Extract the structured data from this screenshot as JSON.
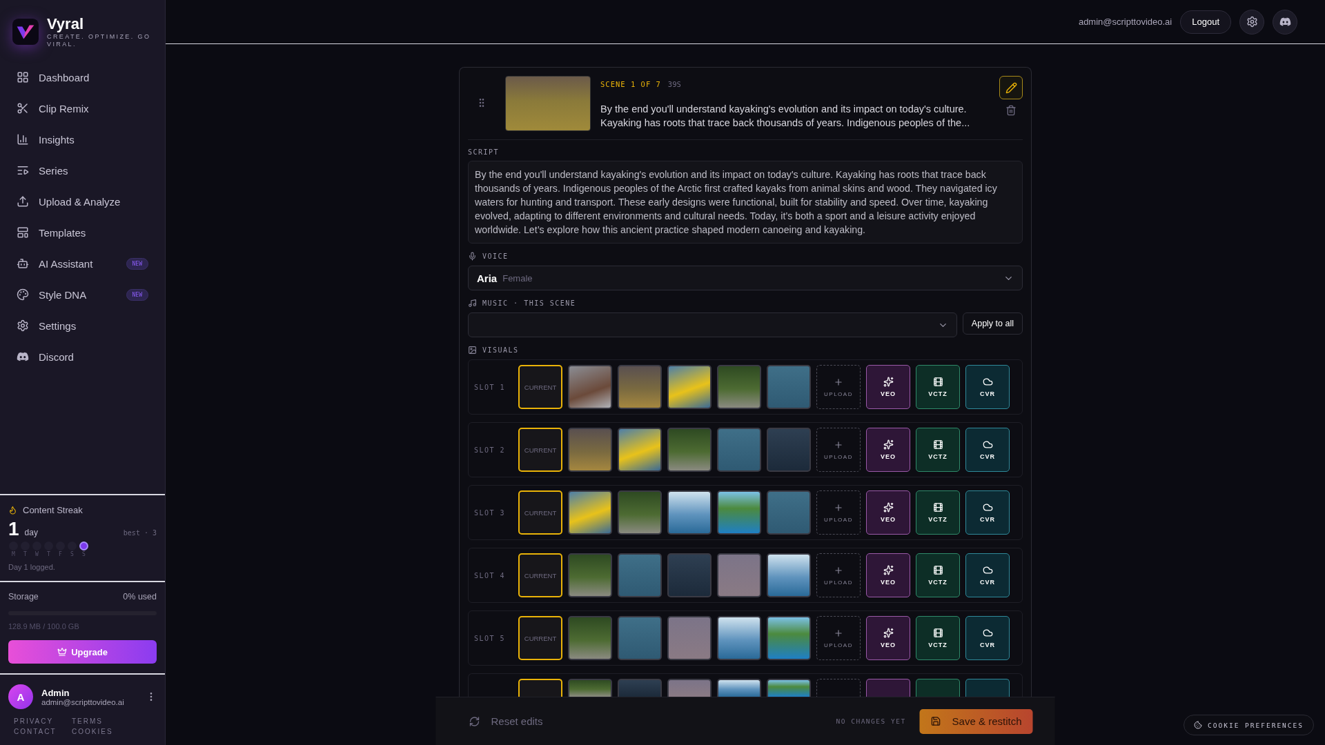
{
  "brand": {
    "name": "Vyral",
    "tagline": "CREATE. OPTIMIZE. GO VIRAL."
  },
  "nav": [
    {
      "label": "Dashboard"
    },
    {
      "label": "Clip Remix"
    },
    {
      "label": "Insights"
    },
    {
      "label": "Series"
    },
    {
      "label": "Upload & Analyze"
    },
    {
      "label": "Templates"
    },
    {
      "label": "AI Assistant",
      "badge": "NEW"
    },
    {
      "label": "Style DNA",
      "badge": "NEW"
    },
    {
      "label": "Settings"
    },
    {
      "label": "Discord"
    }
  ],
  "streak": {
    "title": "Content Streak",
    "count": "1",
    "unit": "day",
    "best": "best · 3",
    "days": [
      {
        "label": "M",
        "done": false
      },
      {
        "label": "T",
        "done": false
      },
      {
        "label": "W",
        "done": false
      },
      {
        "label": "T",
        "done": false
      },
      {
        "label": "F",
        "done": false
      },
      {
        "label": "S",
        "done": false
      },
      {
        "label": "S",
        "done": true
      }
    ],
    "note": "Day 1 logged."
  },
  "storage": {
    "label": "Storage",
    "used": "0% used",
    "detail": "128.9 MB / 100.0 GB"
  },
  "upgrade": "Upgrade",
  "user": {
    "initial": "A",
    "name": "Admin",
    "email": "admin@scripttovideo.ai"
  },
  "footer_links": [
    "PRIVACY",
    "TERMS",
    "CONTACT",
    "COOKIES"
  ],
  "header": {
    "email": "admin@scripttovideo.ai",
    "logout": "Logout"
  },
  "scene": {
    "counter": "SCENE 1 OF 7",
    "duration": "39S",
    "summary": "By the end you'll understand kayaking's evolution and its impact on today's culture. Kayaking has roots that trace back thousands of years. Indigenous peoples of the...",
    "script_label": "SCRIPT",
    "script": "By the end you'll understand kayaking's evolution and its impact on today's culture. Kayaking has roots that trace back thousands of years. Indigenous peoples of the Arctic first crafted kayaks from animal skins and wood. They navigated icy waters for hunting and transport. These early designs were functional, built for stability and speed. Over time, kayaking evolved, adapting to different environments and cultural needs. Today, it’s both a sport and a leisure activity enjoyed worldwide. Let’s explore how this ancient practice shaped modern canoeing and kayaking.",
    "voice_label": "VOICE",
    "voice": {
      "name": "Aria",
      "gender": "Female"
    },
    "music_label": "MUSIC · THIS SCENE",
    "apply_all": "Apply to all",
    "visuals_label": "VISUALS",
    "slots": [
      {
        "kind": "full",
        "label": "SLOT 1",
        "current": "CURRENT",
        "photos": [
          {
            "kind": "crowd"
          },
          {
            "kind": "people"
          },
          {
            "kind": "kayak"
          },
          {
            "kind": "shore"
          },
          {
            "kind": "water"
          }
        ],
        "upload": "UPLOAD",
        "generators": [
          {
            "kind": "veo",
            "label": "VEO"
          },
          {
            "kind": "vctz",
            "label": "VCTZ"
          },
          {
            "kind": "cvr",
            "label": "CVR"
          }
        ]
      },
      {
        "kind": "full",
        "label": "SLOT 2",
        "current": "CURRENT",
        "photos": [
          {
            "kind": "people"
          },
          {
            "kind": "kayak"
          },
          {
            "kind": "shore"
          },
          {
            "kind": "water"
          },
          {
            "kind": "dusk"
          }
        ],
        "upload": "UPLOAD",
        "generators": [
          {
            "kind": "veo",
            "label": "VEO"
          },
          {
            "kind": "vctz",
            "label": "VCTZ"
          },
          {
            "kind": "cvr",
            "label": "CVR"
          }
        ]
      },
      {
        "kind": "full",
        "label": "SLOT 3",
        "current": "CURRENT",
        "photos": [
          {
            "kind": "kayak"
          },
          {
            "kind": "shore"
          },
          {
            "kind": "paddler"
          },
          {
            "kind": "lake"
          },
          {
            "kind": "water"
          }
        ],
        "upload": "UPLOAD",
        "generators": [
          {
            "kind": "veo",
            "label": "VEO"
          },
          {
            "kind": "vctz",
            "label": "VCTZ"
          },
          {
            "kind": "cvr",
            "label": "CVR"
          }
        ]
      },
      {
        "kind": "full",
        "label": "SLOT 4",
        "current": "CURRENT",
        "photos": [
          {
            "kind": "shore"
          },
          {
            "kind": "water"
          },
          {
            "kind": "dusk"
          },
          {
            "kind": "rafters"
          },
          {
            "kind": "paddler"
          }
        ],
        "upload": "UPLOAD",
        "generators": [
          {
            "kind": "veo",
            "label": "VEO"
          },
          {
            "kind": "vctz",
            "label": "VCTZ"
          },
          {
            "kind": "cvr",
            "label": "CVR"
          }
        ]
      },
      {
        "kind": "full",
        "label": "SLOT 5",
        "current": "CURRENT",
        "photos": [
          {
            "kind": "shore"
          },
          {
            "kind": "water"
          },
          {
            "kind": "rafters"
          },
          {
            "kind": "paddler"
          },
          {
            "kind": "lake"
          }
        ],
        "upload": "UPLOAD",
        "generators": [
          {
            "kind": "veo",
            "label": "VEO"
          },
          {
            "kind": "vctz",
            "label": "VCTZ"
          },
          {
            "kind": "cvr",
            "label": "CVR"
          }
        ]
      },
      {
        "kind": "partial",
        "photos": [
          {
            "kind": "shore"
          },
          {
            "kind": "dusk"
          },
          {
            "kind": "rafters"
          },
          {
            "kind": "paddler"
          },
          {
            "kind": "lake"
          }
        ],
        "generators": [
          {
            "kind": "veo"
          },
          {
            "kind": "vctz"
          },
          {
            "kind": "cvr"
          }
        ]
      }
    ]
  },
  "bottom_bar": {
    "reset": "Reset edits",
    "status": "NO CHANGES YET",
    "save": "Save & restitch"
  },
  "cookie": "COOKIE PREFERENCES"
}
